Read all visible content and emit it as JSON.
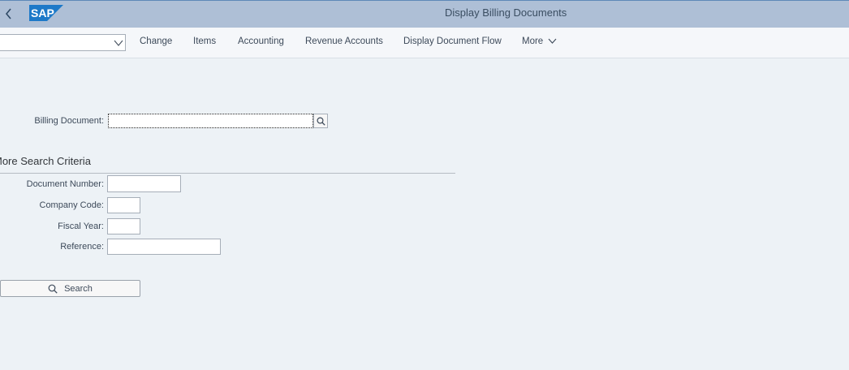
{
  "header": {
    "title": "Display Billing Documents",
    "logo_text": "SAP",
    "back_icon": "chevron-left-icon"
  },
  "toolbar": {
    "tcode_value": "",
    "buttons": [
      "Change",
      "Items",
      "Accounting",
      "Revenue Accounts",
      "Display Document Flow"
    ],
    "more_label": "More"
  },
  "form": {
    "billing_document": {
      "label": "Billing Document:",
      "value": ""
    },
    "section_title": "More Search Criteria",
    "fields": [
      {
        "label": "Document Number:",
        "value": ""
      },
      {
        "label": "Company Code:",
        "value": ""
      },
      {
        "label": "Fiscal Year:",
        "value": ""
      },
      {
        "label": "Reference:",
        "value": ""
      }
    ],
    "search_label": "Search"
  },
  "colors": {
    "shell": "#aebfd6",
    "background": "#edf2f6",
    "brand": "#1d79c8"
  }
}
